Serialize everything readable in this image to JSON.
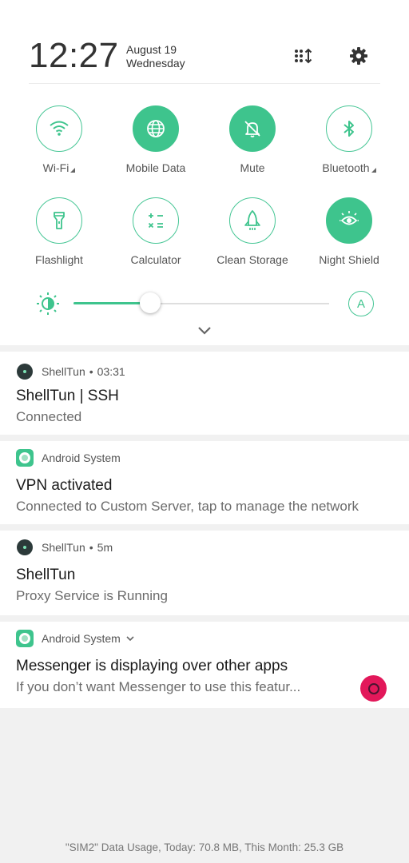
{
  "header": {
    "time": "12:27",
    "date_line1": "August 19",
    "date_line2": "Wednesday",
    "edit_icon": "tiles-edit-icon",
    "settings_icon": "gear-icon"
  },
  "tiles": [
    {
      "label": "Wi-Fi",
      "icon": "wifi-icon",
      "active": false,
      "has_more": true
    },
    {
      "label": "Mobile Data",
      "icon": "globe-icon",
      "active": true,
      "has_more": false
    },
    {
      "label": "Mute",
      "icon": "bell-off-icon",
      "active": true,
      "has_more": false
    },
    {
      "label": "Bluetooth",
      "icon": "bluetooth-icon",
      "active": false,
      "has_more": true
    },
    {
      "label": "Flashlight",
      "icon": "flashlight-icon",
      "active": false,
      "has_more": false
    },
    {
      "label": "Calculator",
      "icon": "calculator-icon",
      "active": false,
      "has_more": false
    },
    {
      "label": "Clean Storage",
      "icon": "rocket-icon",
      "active": false,
      "has_more": false
    },
    {
      "label": "Night Shield",
      "icon": "eye-icon",
      "active": true,
      "has_more": false
    }
  ],
  "brightness": {
    "level": 0.3,
    "auto_label": "A",
    "icon": "brightness-icon"
  },
  "colors": {
    "accent": "#3ec48d",
    "messenger": "#e2185a"
  },
  "notifications": [
    {
      "app": "ShellTun",
      "time": "03:31",
      "title": "ShellTun | SSH",
      "body": "Connected"
    },
    {
      "app": "Android System",
      "title": "VPN activated",
      "body": "Connected to Custom Server, tap to manage the network"
    },
    {
      "app": "ShellTun",
      "time": "5m",
      "title": "ShellTun",
      "body": "Proxy Service is Running"
    },
    {
      "app": "Android System",
      "title": "Messenger is displaying over other apps",
      "body": "If you don’t want Messenger to use this featur..."
    }
  ],
  "footer": {
    "data_usage": "\"SIM2\" Data Usage, Today: 70.8 MB, This Month: 25.3 GB"
  }
}
